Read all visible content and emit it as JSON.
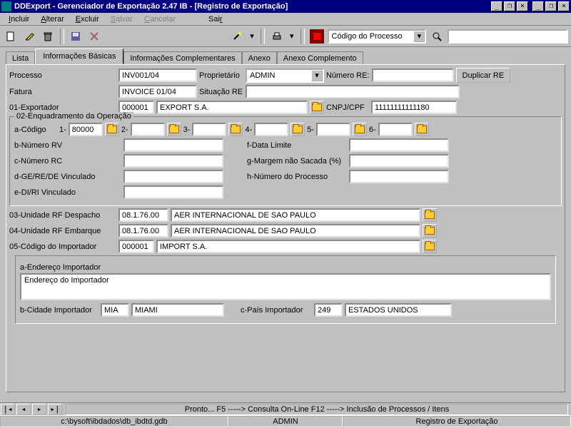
{
  "title": "DDExport - Gerenciador de Exportação 2.47 IB - [Registro de Exportação]",
  "menu": {
    "incluir": "Incluir",
    "alterar": "Alterar",
    "excluir": "Excluir",
    "salvar": "Salvar",
    "cancelar": "Cancelar",
    "sair": "Sair"
  },
  "toolbar": {
    "search_combo": "Código do Processo"
  },
  "tabs": {
    "lista": "Lista",
    "basicas": "Informações Básicas",
    "compl": "Informações Complementares",
    "anexo": "Anexo",
    "anexocomp": "Anexo Complemento"
  },
  "form": {
    "processo_lbl": "Processo",
    "processo_val": "INV001/04",
    "proprietario_lbl": "Proprietário",
    "proprietario_val": "ADMIN",
    "numero_re_lbl": "Número RE:",
    "numero_re_val": "",
    "duplicar_btn": "Duplicar RE",
    "fatura_lbl": "Fatura",
    "fatura_val": "INVOICE 01/04",
    "situacao_lbl": "Situação RE",
    "situacao_val": "",
    "exportador_lbl": "01-Exportador",
    "exportador_code": "000001",
    "exportador_name": "EXPORT S.A.",
    "cnpj_lbl": "CNPJ/CPF",
    "cnpj_val": "11111111111180",
    "enq_legend": "02-Enquadramento da Operação",
    "a_codigo_lbl": "a-Código",
    "a1_lbl": "1-",
    "a1_val": "80000",
    "a2_lbl": "2-",
    "a2_val": "",
    "a3_lbl": "3-",
    "a3_val": "",
    "a4_lbl": "4-",
    "a4_val": "",
    "a5_lbl": "5-",
    "a5_val": "",
    "a6_lbl": "6-",
    "a6_val": "",
    "b_lbl": "b-Número RV",
    "b_val": "",
    "c_lbl": "c-Número RC",
    "c_val": "",
    "d_lbl": "d-GE/RE/DE Vinculado",
    "d_val": "",
    "e_lbl": "e-DI/RI Vinculado",
    "e_val": "",
    "f_lbl": "f-Data Limite",
    "f_val": "",
    "g_lbl": "g-Margem não Sacada (%)",
    "g_val": "",
    "h_lbl": "h-Número do Processo",
    "h_val": "",
    "rf_desp_lbl": "03-Unidade RF Despacho",
    "rf_desp_code": "08.1.76.00",
    "rf_desp_name": "AER INTERNACIONAL DE SAO PAULO",
    "rf_emb_lbl": "04-Unidade RF Embarque",
    "rf_emb_code": "08.1.76.00",
    "rf_emb_name": "AER INTERNACIONAL DE SAO PAULO",
    "imp_lbl": "05-Código do Importador",
    "imp_code": "000001",
    "imp_name": "IMPORT S.A.",
    "end_lbl": "a-Endereço Importador",
    "end_val": "Endereço do Importador",
    "cidade_lbl": "b-Cidade Importador",
    "cidade_code": "MIA",
    "cidade_name": "MIAMI",
    "pais_lbl": "c-País Importador",
    "pais_code": "249",
    "pais_name": "ESTADOS UNIDOS"
  },
  "nav": {
    "msg": "Pronto...      F5 -----> Consulta On-Line  F12 -----> Inclusão de Processos / Itens"
  },
  "status": {
    "path": "c:\\bysoft\\ibdados\\db_ibdtd.gdb",
    "user": "ADMIN",
    "screen": "Registro de Exportação"
  }
}
